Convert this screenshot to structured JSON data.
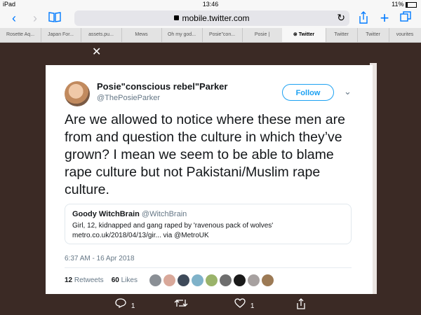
{
  "status": {
    "device": "iPad",
    "time": "13:46",
    "battery": "11%"
  },
  "browser": {
    "url": "mobile.twitter.com",
    "back_icon": "chevron-left",
    "forward_icon": "chevron-right"
  },
  "tabs": [
    {
      "label": "Rosette Aq..."
    },
    {
      "label": "Japan For..."
    },
    {
      "label": "assets.pu..."
    },
    {
      "label": "Mews"
    },
    {
      "label": "Oh my god..."
    },
    {
      "label": "Posie\"con..."
    },
    {
      "label": "Posie |"
    },
    {
      "label": "Twitter",
      "active": true
    },
    {
      "label": "Twitter"
    },
    {
      "label": "Twitter"
    },
    {
      "label": "vourites"
    }
  ],
  "tweet": {
    "author": "Posie\"conscious rebel\"Parker",
    "handle": "@ThePosieParker",
    "follow_label": "Follow",
    "text": "Are we allowed to notice where these men are from and question the culture in which they’ve grown?   I mean we seem to be able to blame rape culture but not Pakistani/Muslim rape culture.",
    "quote": {
      "name": "Goody WitchBrain",
      "handle": "@WitchBrain",
      "text": "Girl, 12, kidnapped and gang raped by 'ravenous pack of wolves' metro.co.uk/2018/04/13/gir... via @MetroUK"
    },
    "timestamp": "6:37 AM - 16 Apr 2018",
    "retweets_count": "12",
    "retweets_label": "Retweets",
    "likes_count": "60",
    "likes_label": "Likes"
  },
  "actions": {
    "reply_count": "1",
    "like_count": "1"
  },
  "colors": {
    "accent": "#1da1f2",
    "background": "#3b2a25",
    "ios_blue": "#007aff"
  }
}
